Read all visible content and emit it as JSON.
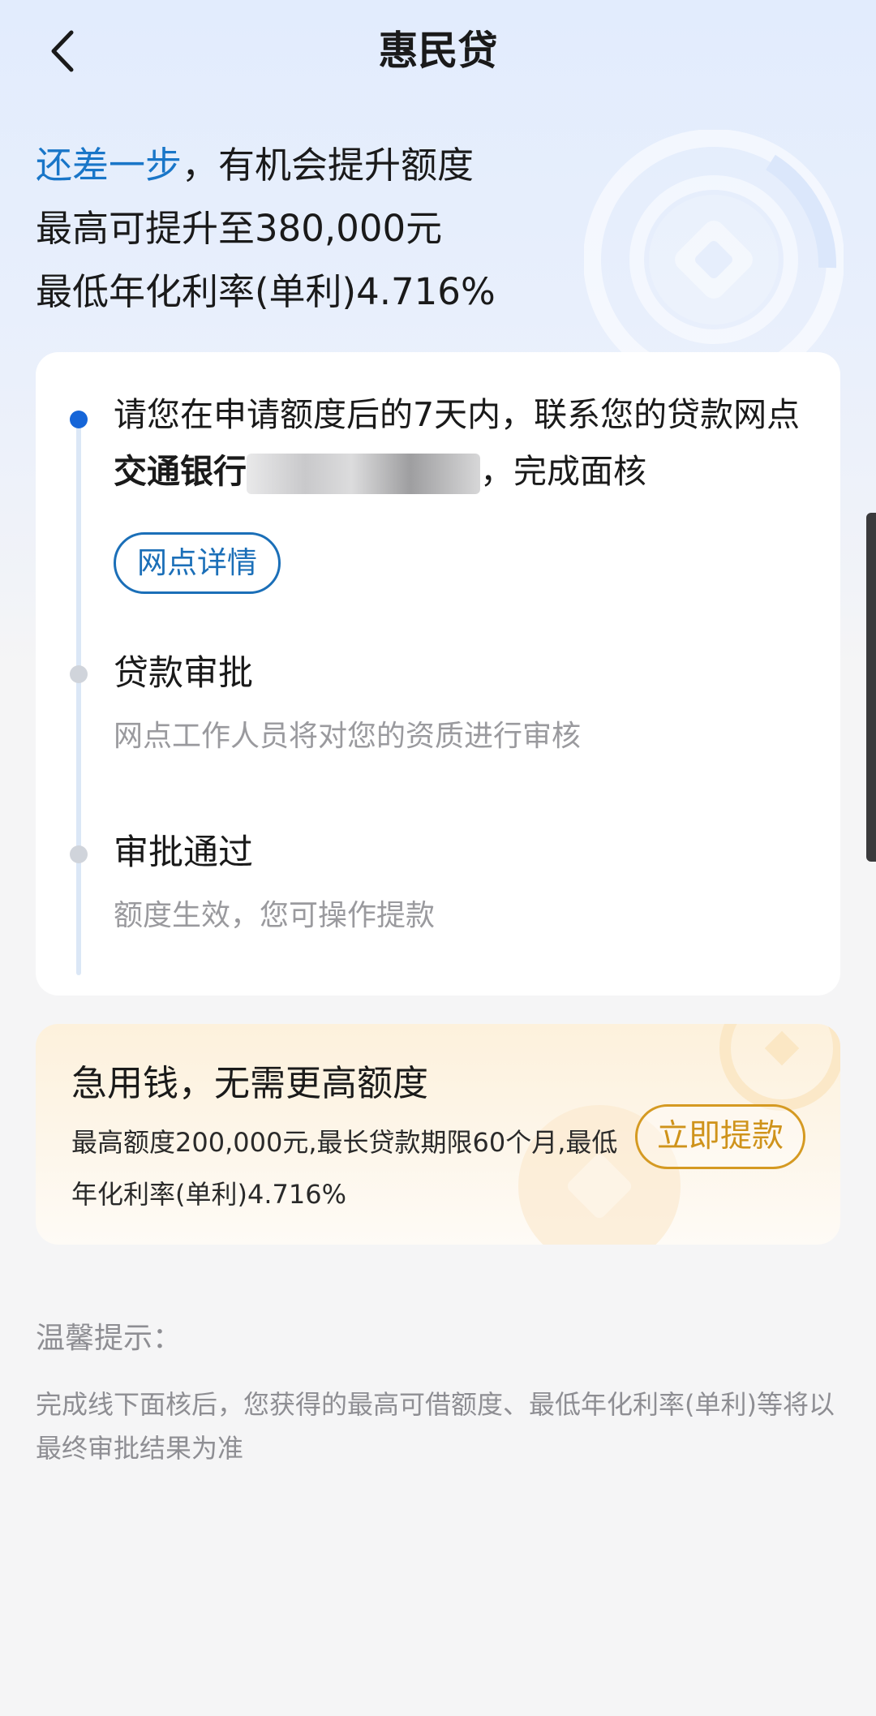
{
  "header": {
    "title": "惠民贷",
    "back_icon": "chevron-left-icon"
  },
  "hero": {
    "accent_text": "还差一步",
    "line1_rest": "，有机会提升额度",
    "line2": "最高可提升至380,000元",
    "line3": "最低年化利率(单利)4.716%",
    "accent_color": "#1976c8"
  },
  "steps": {
    "step1": {
      "text_before": "请您在申请额度后的7天内，联系您的贷款网点 ",
      "bank_name": "交通银行",
      "text_after": "，完成面核",
      "button_label": "网点详情"
    },
    "step2": {
      "title": "贷款审批",
      "desc": "网点工作人员将对您的资质进行审核"
    },
    "step3": {
      "title": "审批通过",
      "desc": "额度生效，您可操作提款"
    },
    "active_color": "#1565d8"
  },
  "promo": {
    "title": "急用钱，无需更高额度",
    "desc": "最高额度200,000元,最长贷款期限60个月,最低年化利率(单利)4.716%",
    "button_label": "立即提款",
    "button_color": "#cf931b"
  },
  "tips": {
    "title": "温馨提示：",
    "text": "完成线下面核后，您获得的最高可借额度、最低年化利率(单利)等将以最终审批结果为准"
  }
}
